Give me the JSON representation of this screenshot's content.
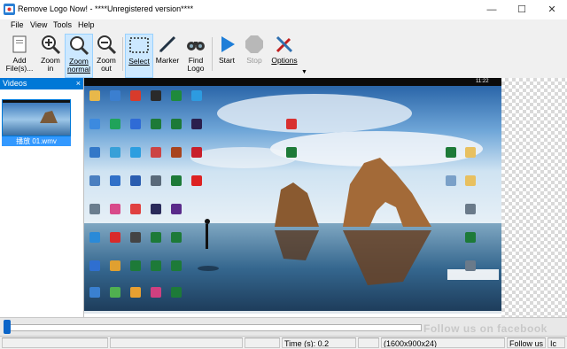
{
  "window": {
    "title": "Remove Logo Now! - ****Unregistered version****",
    "controls": [
      "—",
      "☐",
      "✕"
    ]
  },
  "menu": [
    "File",
    "View",
    "Tools",
    "Help"
  ],
  "toolbar": {
    "add_files": "Add\nFile(s)...",
    "zoom_in": "Zoom\nin",
    "zoom_normal": "Zoom\nnormal",
    "zoom_out": "Zoom\nout",
    "select": "Select",
    "marker": "Marker",
    "find_logo": "Find\nLogo",
    "start": "Start",
    "stop": "Stop",
    "options": "Options"
  },
  "videos_panel": {
    "header": "Videos",
    "close": "×",
    "item_label": "播放 01.wmv"
  },
  "timeline": {
    "position": 0.0,
    "watermark": "Follow us on facebook"
  },
  "status": {
    "time": "Time (s): 0.2",
    "resolution": "(1600x900x24)",
    "follow": "Follow us",
    "tail": "Ic"
  },
  "preview": {
    "taskbar_time": "11:22"
  }
}
